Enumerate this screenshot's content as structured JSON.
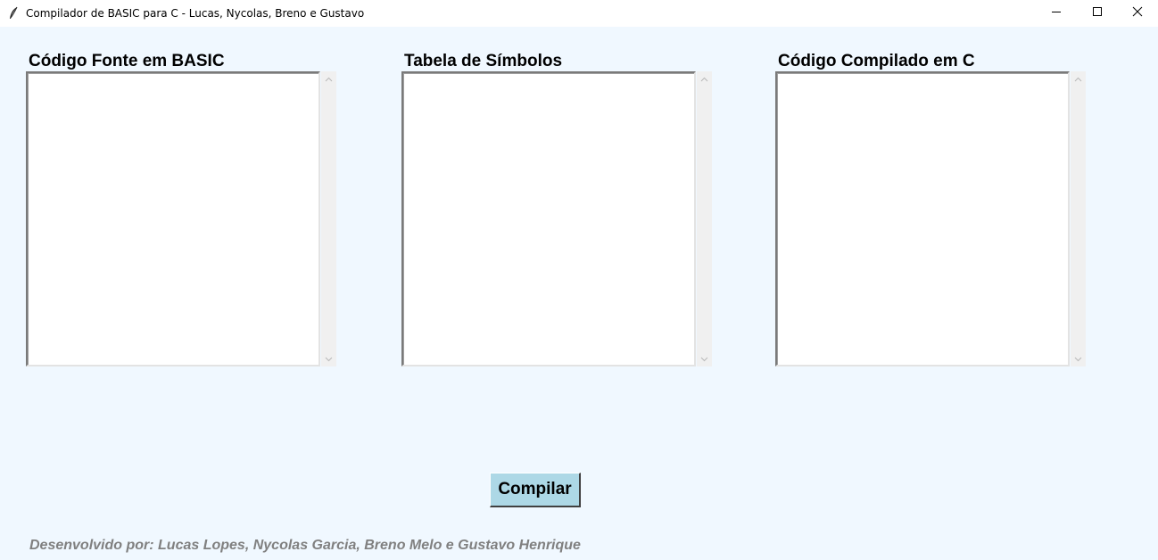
{
  "window": {
    "title": "Compilador de BASIC para C - Lucas, Nycolas, Breno e Gustavo",
    "icon": "feather-icon",
    "controls": [
      "minimize-icon",
      "maximize-icon",
      "close-icon"
    ]
  },
  "panels": {
    "source": {
      "label": "Código Fonte em BASIC",
      "value": ""
    },
    "symbols": {
      "label": "Tabela de Símbolos",
      "value": ""
    },
    "compiled": {
      "label": "Código Compilado em C",
      "value": ""
    }
  },
  "actions": {
    "compile_label": "Compilar"
  },
  "footer": {
    "credits": "Desenvolvido por: Lucas Lopes, Nycolas Garcia, Breno Melo e Gustavo Henrique"
  },
  "colors": {
    "background": "#f0f8ff",
    "button": "#add8e6",
    "footer_text": "#808080"
  }
}
